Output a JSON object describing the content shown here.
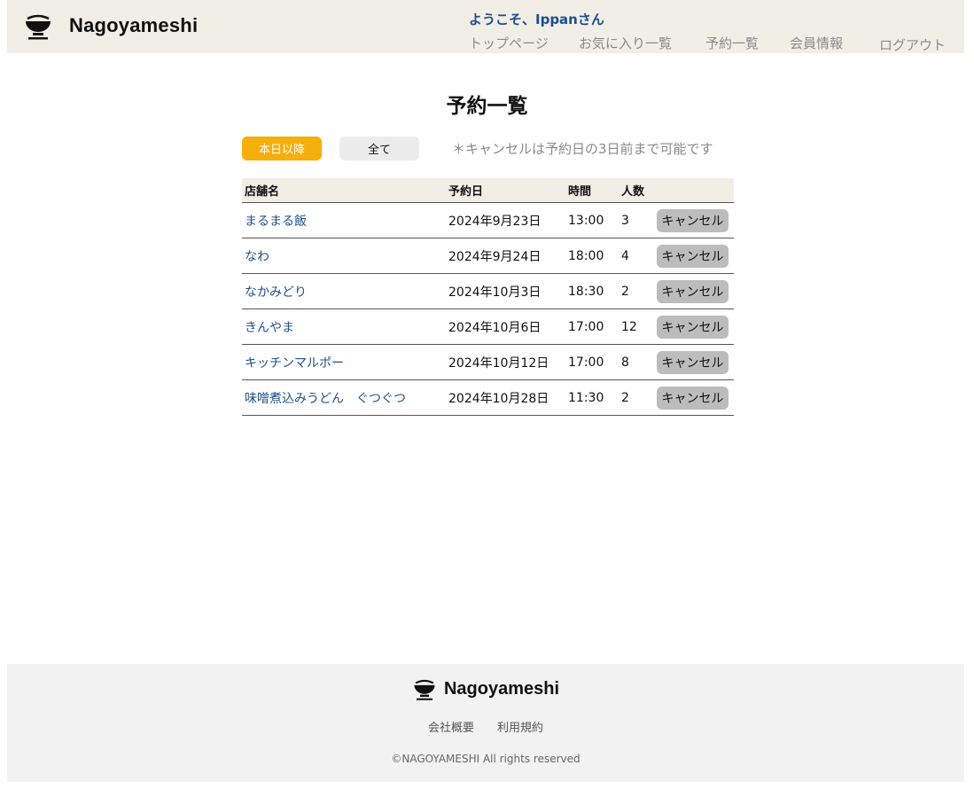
{
  "header": {
    "brand_name": "Nagoyameshi",
    "welcome": "ようこそ、Ippanさん",
    "nav": [
      {
        "label": "トップページ"
      },
      {
        "label": "お気に入り一覧"
      },
      {
        "label": "予約一覧"
      },
      {
        "label": "会員情報"
      },
      {
        "label": "ログアウト"
      }
    ]
  },
  "main": {
    "title": "予約一覧",
    "filters": {
      "upcoming": "本日以降",
      "all": "全て"
    },
    "cancel_note": "＊キャンセルは予約日の3日前まで可能です",
    "table": {
      "headers": {
        "name": "店舗名",
        "date": "予約日",
        "time": "時間",
        "people": "人数"
      },
      "cancel_label": "キャンセル",
      "rows": [
        {
          "name": "まるまる飯",
          "date": "2024年9月23日",
          "time": "13:00",
          "people": "3",
          "cancel": "キャンセル"
        },
        {
          "name": "なわ",
          "date": "2024年9月24日",
          "time": "18:00",
          "people": "4",
          "cancel": "キャンセル"
        },
        {
          "name": "なかみどり",
          "date": "2024年10月3日",
          "time": "18:30",
          "people": "2",
          "cancel": "キャンセル"
        },
        {
          "name": "きんやま",
          "date": "2024年10月6日",
          "time": "17:00",
          "people": "12",
          "cancel": "キャンセル"
        },
        {
          "name": "キッチンマルポー",
          "date": "2024年10月12日",
          "time": "17:00",
          "people": "8",
          "cancel": "キャンセル"
        },
        {
          "name": "味噌煮込みうどん　ぐつぐつ",
          "date": "2024年10月28日",
          "time": "11:30",
          "people": "2",
          "cancel": "キャンセル"
        }
      ]
    }
  },
  "footer": {
    "brand_name": "Nagoyameshi",
    "links": [
      {
        "label": "会社概要"
      },
      {
        "label": "利用規約"
      }
    ],
    "copyright": "©NAGOYAMESHI All rights reserved"
  },
  "colors": {
    "accent": "#f6ae0a",
    "header_bg": "#f1eee6",
    "link": "#1d4f8c"
  }
}
